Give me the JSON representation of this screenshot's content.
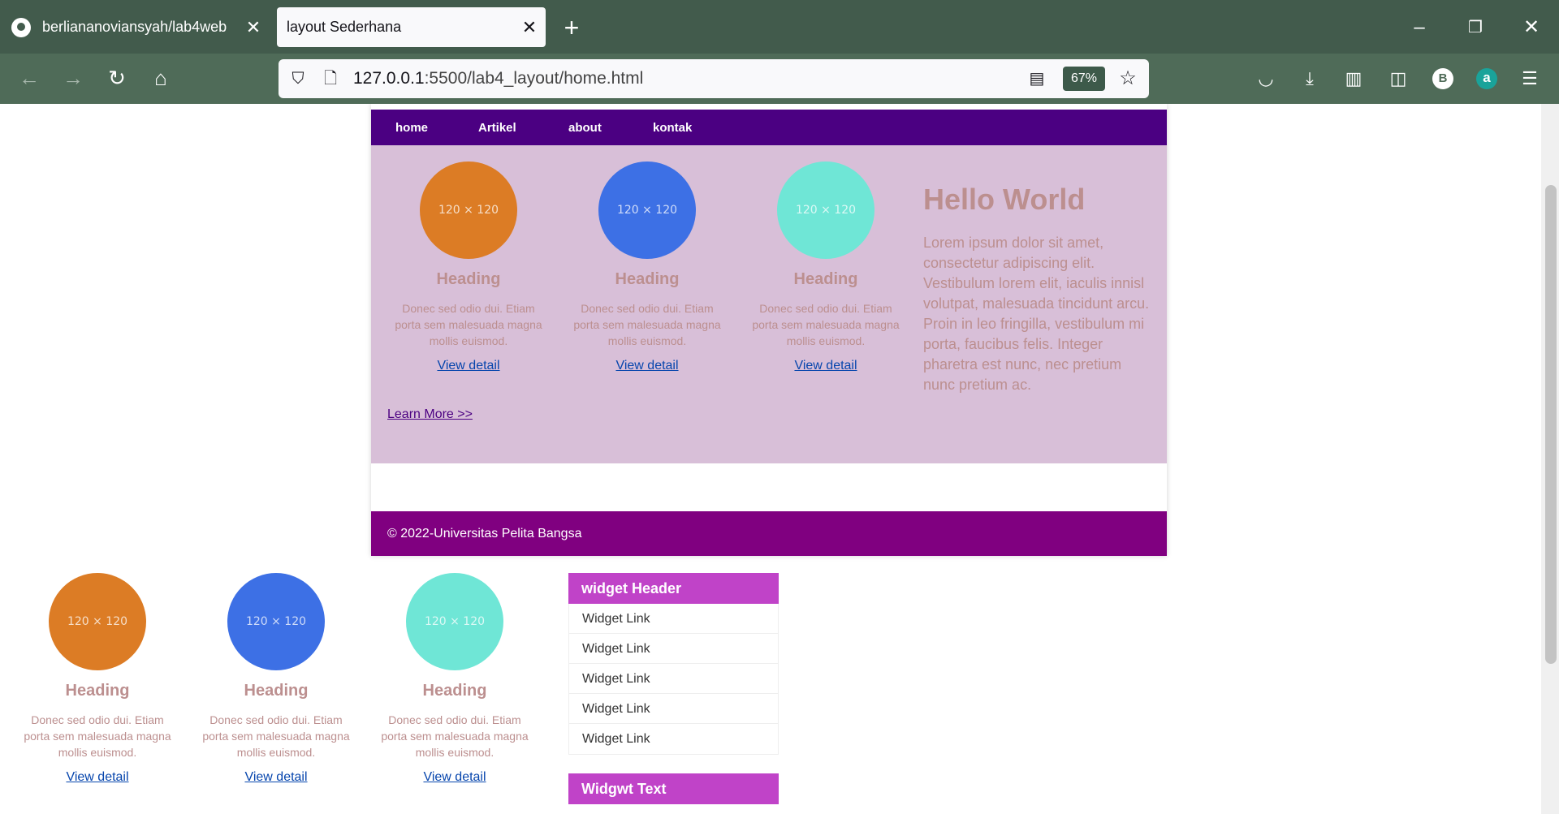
{
  "browser": {
    "tabs": [
      {
        "title": "berliananoviansyah/lab4web",
        "active": false
      },
      {
        "title": "layout Sederhana",
        "active": true
      }
    ],
    "url_host": "127.0.0.1",
    "url_path": ":5500/lab4_layout/home.html",
    "zoom": "67%",
    "profile_initial": "B",
    "extension_letter": "a"
  },
  "site": {
    "nav": [
      "home",
      "Artikel",
      "about",
      "kontak"
    ],
    "cards": [
      {
        "placeholder": "120 × 120",
        "color": "#dc7c25",
        "heading": "Heading",
        "text": "Donec sed odio dui. Etiam porta sem malesuada magna mollis euismod.",
        "link": "View detail"
      },
      {
        "placeholder": "120 × 120",
        "color": "#3d70e5",
        "heading": "Heading",
        "text": "Donec sed odio dui. Etiam porta sem malesuada magna mollis euismod.",
        "link": "View detail"
      },
      {
        "placeholder": "120 × 120",
        "color": "#6fe6d6",
        "heading": "Heading",
        "text": "Donec sed odio dui. Etiam porta sem malesuada magna mollis euismod.",
        "link": "View detail"
      }
    ],
    "hero_title": "Hello World",
    "hero_text": "Lorem ipsum dolor sit amet, consectetur adipiscing elit. Vestibulum lorem elit, iaculis innisl volutpat, malesuada tincidunt arcu. Proin in leo fringilla, vestibulum mi porta, faucibus felis. Integer pharetra est nunc, nec pretium nunc pretium ac.",
    "learn_more": "Learn More >>",
    "footer": "© 2022-Universitas Pelita Bangsa",
    "widget_header": "widget Header",
    "widget_links": [
      "Widget Link",
      "Widget Link",
      "Widget Link",
      "Widget Link",
      "Widget Link"
    ],
    "widget2_header": "Widgwt Text"
  },
  "colors": {
    "nav_bg": "#4b0082",
    "hero_bg": "#d8bfd8",
    "footer_bg": "#800080",
    "widget_header_bg": "#c043c8",
    "heading_text": "#bc8f8f"
  }
}
